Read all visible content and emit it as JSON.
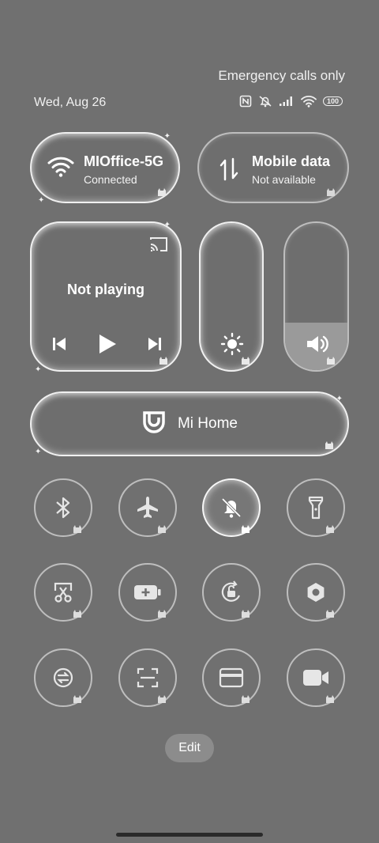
{
  "status_bar": {
    "carrier": "Emergency calls only",
    "date": "Wed, Aug 26",
    "battery": "100",
    "icons": [
      "nfc-icon",
      "silent-icon",
      "signal-icon",
      "wifi-icon",
      "battery-icon"
    ]
  },
  "wifi": {
    "title": "MIOffice-5G",
    "status": "Connected"
  },
  "mobile_data": {
    "title": "Mobile data",
    "status": "Not available"
  },
  "media": {
    "title": "Not playing"
  },
  "brightness": {
    "level": 0.0
  },
  "volume": {
    "level": 0.32
  },
  "mi_home": {
    "label": "Mi Home"
  },
  "toggles": [
    {
      "name": "bluetooth",
      "active": false
    },
    {
      "name": "airplane-mode",
      "active": false
    },
    {
      "name": "silent-mode",
      "active": true
    },
    {
      "name": "flashlight",
      "active": false
    },
    {
      "name": "screenshot",
      "active": false
    },
    {
      "name": "battery-saver",
      "active": false
    },
    {
      "name": "rotation-lock",
      "active": false
    },
    {
      "name": "settings",
      "active": false
    },
    {
      "name": "data-saver",
      "active": false
    },
    {
      "name": "scanner",
      "active": false
    },
    {
      "name": "card",
      "active": false
    },
    {
      "name": "screen-recorder",
      "active": false
    }
  ],
  "edit": {
    "label": "Edit"
  },
  "colors": {
    "background": "#707070",
    "tile_border": "#ffffff",
    "text": "#ffffff"
  }
}
